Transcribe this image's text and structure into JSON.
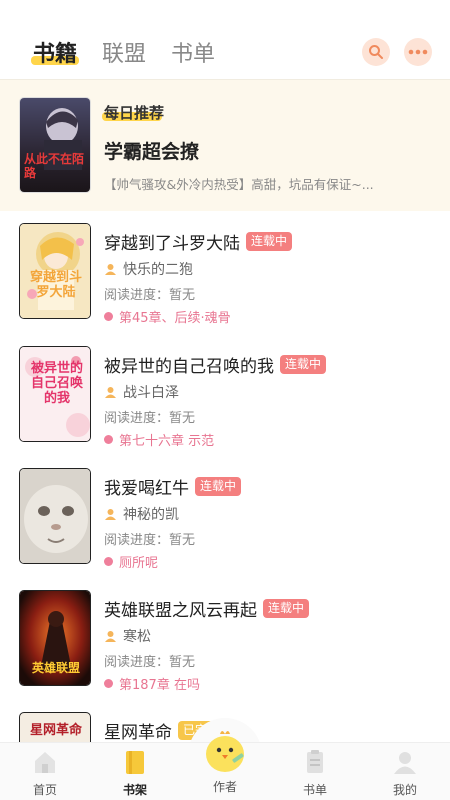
{
  "tabs": [
    {
      "label": "书籍",
      "active": true
    },
    {
      "label": "联盟",
      "active": false
    },
    {
      "label": "书单",
      "active": false
    }
  ],
  "header_icons": [
    "search-icon",
    "more-icon"
  ],
  "colors": {
    "accent": "#ffd54a",
    "status_serial": "#f47f7f",
    "status_done": "#f7c64a",
    "chapter": "#e87591"
  },
  "recommend": {
    "badge": "每日推荐",
    "title": "学霸超会撩",
    "description": "【帅气骚攻&外冷内热受】高甜，坑品有保证~...",
    "cover_text": "从此不在陌路"
  },
  "books": [
    {
      "title": "穿越到了斗罗大陆",
      "status": "连载中",
      "author": "快乐的二狍",
      "progress": "阅读进度：暂无",
      "latest": "第45章、后续·魂骨",
      "cover_text": "穿越到斗罗大陆"
    },
    {
      "title": "被异世的自己召唤的我",
      "status": "连载中",
      "author": "战斗白泽",
      "progress": "阅读进度：暂无",
      "latest": "第七十六章 示范",
      "cover_text": "被异世的自己召唤的我"
    },
    {
      "title": "我爱喝红牛",
      "status": "连载中",
      "author": "神秘的凯",
      "progress": "阅读进度：暂无",
      "latest": "厕所呢",
      "cover_text": ""
    },
    {
      "title": "英雄联盟之风云再起",
      "status": "连载中",
      "author": "寒松",
      "progress": "阅读进度：暂无",
      "latest": "第187章 在吗",
      "cover_text": "英雄联盟"
    },
    {
      "title": "星网革命",
      "status": "已完结",
      "author": "",
      "progress": "",
      "latest": "",
      "cover_text": "星网革命"
    }
  ],
  "nav": [
    {
      "label": "首页",
      "icon": "home-icon",
      "active": false
    },
    {
      "label": "书架",
      "icon": "bookshelf-icon",
      "active": true
    },
    {
      "label": "作者",
      "icon": "chick-icon",
      "active": false
    },
    {
      "label": "书单",
      "icon": "booklist-icon",
      "active": false
    },
    {
      "label": "我的",
      "icon": "profile-icon",
      "active": false
    }
  ]
}
